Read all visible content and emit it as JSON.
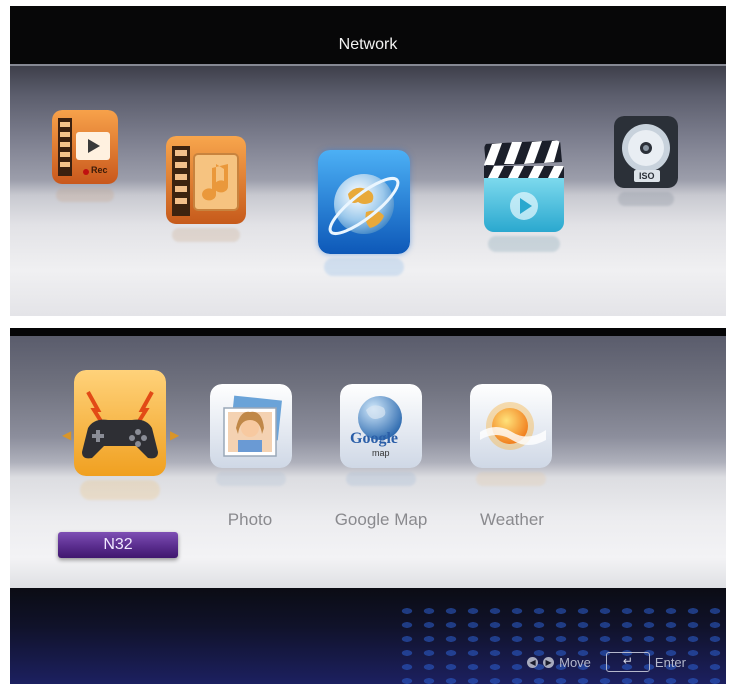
{
  "screen1": {
    "title": "Network",
    "icons": [
      {
        "name": "pvr-rec",
        "text": "Rec",
        "selected": false
      },
      {
        "name": "music-folder",
        "selected": false
      },
      {
        "name": "network-globe",
        "selected": true
      },
      {
        "name": "movie-clapper",
        "selected": false
      },
      {
        "name": "iso-disc",
        "text": "ISO",
        "selected": false
      }
    ]
  },
  "screen2": {
    "apps": [
      {
        "id": "n32",
        "label": "N32",
        "selected": true,
        "icon": "gamepad-icon"
      },
      {
        "id": "photo",
        "label": "Photo",
        "selected": false,
        "icon": "photo-icon"
      },
      {
        "id": "google-map",
        "label": "Google Map",
        "selected": false,
        "icon": "google-map-icon",
        "icon_text_main": "Google",
        "icon_text_sub": "map"
      },
      {
        "id": "weather",
        "label": "Weather",
        "selected": false,
        "icon": "weather-icon"
      }
    ],
    "help": {
      "move_label": "Move",
      "enter_label": "Enter"
    }
  },
  "colors": {
    "highlight_orange": "#f0a020",
    "label_purple": "#5a2d8e",
    "globe_blue": "#1a7ed8"
  }
}
